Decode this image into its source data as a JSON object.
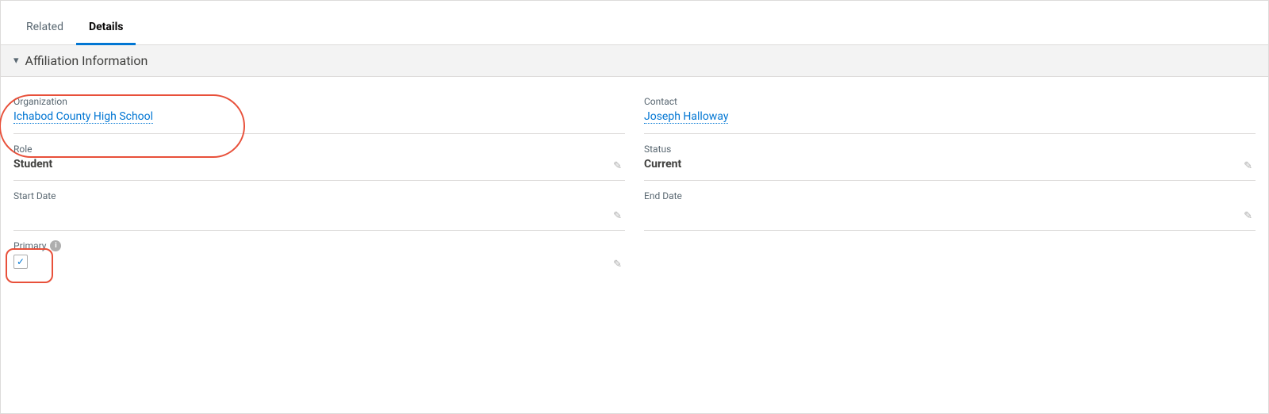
{
  "tabs": [
    {
      "id": "related",
      "label": "Related",
      "active": false
    },
    {
      "id": "details",
      "label": "Details",
      "active": true
    }
  ],
  "section": {
    "title": "Affiliation Information",
    "chevron": "▾"
  },
  "fields": {
    "organization_label": "Organization",
    "organization_value": "Ichabod County High School",
    "contact_label": "Contact",
    "contact_value": "Joseph Halloway",
    "role_label": "Role",
    "role_value": "Student",
    "status_label": "Status",
    "status_value": "Current",
    "start_date_label": "Start Date",
    "start_date_value": "",
    "end_date_label": "End Date",
    "end_date_value": "",
    "primary_label": "Primary",
    "primary_info_icon": "i",
    "primary_checked": true,
    "edit_icon": "✎"
  }
}
